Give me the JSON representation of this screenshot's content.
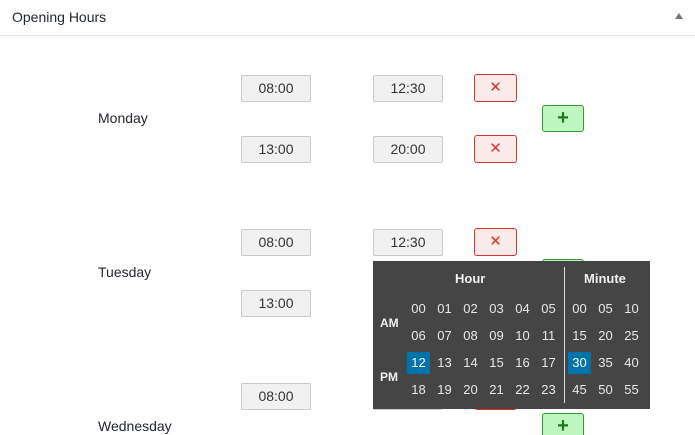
{
  "panel": {
    "title": "Opening Hours"
  },
  "days": [
    {
      "label": "Monday",
      "ranges": [
        {
          "start": "08:00",
          "end": "12:30"
        },
        {
          "start": "13:00",
          "end": "20:00"
        }
      ]
    },
    {
      "label": "Tuesday",
      "ranges": [
        {
          "start": "08:00",
          "end": "12:30"
        },
        {
          "start": "13:00",
          "end": ""
        }
      ]
    },
    {
      "label": "Wednesday",
      "ranges": [
        {
          "start": "08:00",
          "end": ""
        }
      ]
    }
  ],
  "buttons": {
    "remove_symbol": "✕",
    "add_symbol": "+"
  },
  "timepicker": {
    "hour_header": "Hour",
    "minute_header": "Minute",
    "am_label": "AM",
    "pm_label": "PM",
    "hours": [
      [
        "00",
        "01",
        "02",
        "03",
        "04",
        "05"
      ],
      [
        "06",
        "07",
        "08",
        "09",
        "10",
        "11"
      ],
      [
        "12",
        "13",
        "14",
        "15",
        "16",
        "17"
      ],
      [
        "18",
        "19",
        "20",
        "21",
        "22",
        "23"
      ]
    ],
    "minutes": [
      [
        "00",
        "05",
        "10"
      ],
      [
        "15",
        "20",
        "25"
      ],
      [
        "30",
        "35",
        "40"
      ],
      [
        "45",
        "50",
        "55"
      ]
    ],
    "selected_hour": "12",
    "selected_minute": "30"
  },
  "colors": {
    "selected": "#0073aa",
    "picker_bg": "#454545",
    "remove": "#dc3232",
    "add": "#bff5bf"
  }
}
